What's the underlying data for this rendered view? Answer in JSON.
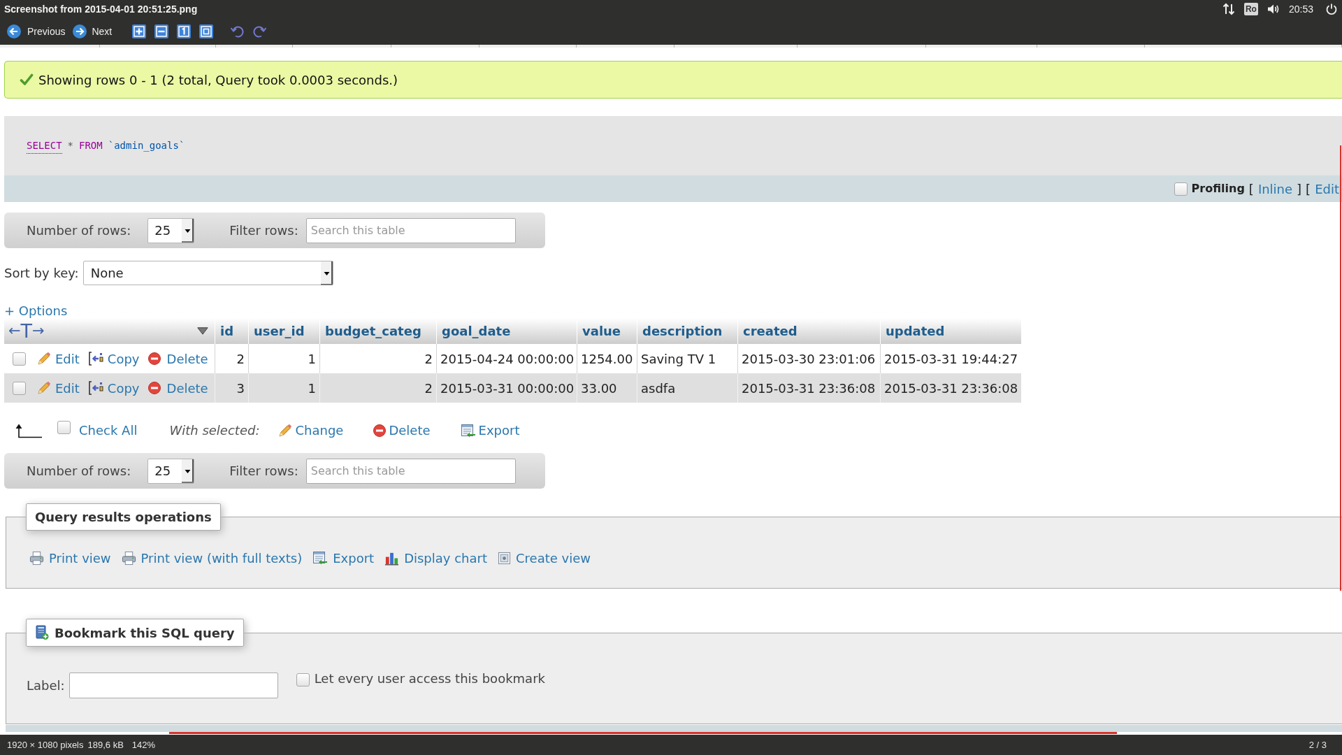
{
  "viewer": {
    "title": "Screenshot from 2015-04-01 20:51:25.png",
    "keyboard": "Ro",
    "time": "20:53",
    "previous": "Previous",
    "next": "Next"
  },
  "message": {
    "text": "Showing rows 0 - 1 (2 total, Query took 0.0003 seconds.)"
  },
  "sql": [
    {
      "kind": "keyword_link",
      "text": "SELECT"
    },
    {
      "kind": "operator",
      "text": "*"
    },
    {
      "kind": "keyword",
      "text": "FROM"
    },
    {
      "kind": "identifier",
      "text": "`admin_goals`"
    }
  ],
  "profiling": {
    "checked": false,
    "label": "Profiling",
    "parts": [
      {
        "kind": "text",
        "text": "["
      },
      {
        "kind": "link",
        "text": "Inline"
      },
      {
        "kind": "text",
        "text": "]"
      },
      {
        "kind": "text",
        "text": "["
      },
      {
        "kind": "link",
        "text": "Edit"
      }
    ]
  },
  "rows_controls_top": {
    "rows_label": "Number of rows:",
    "rows_value": "25",
    "filter_label": "Filter rows:",
    "filter_placeholder": "Search this table"
  },
  "sort": {
    "label": "Sort by key:",
    "value": "None"
  },
  "options": "+ Options",
  "table": {
    "toggle": {
      "left": "←",
      "middle": "T",
      "right": "→"
    },
    "columns": [
      {
        "label": "id",
        "kind": "number"
      },
      {
        "label": "user_id",
        "kind": "number"
      },
      {
        "label": "budget_categ",
        "kind": "number"
      },
      {
        "label": "goal_date",
        "kind": "text"
      },
      {
        "label": "value",
        "kind": "text"
      },
      {
        "label": "description",
        "kind": "text"
      },
      {
        "label": "created",
        "kind": "text"
      },
      {
        "label": "updated",
        "kind": "text"
      }
    ],
    "rows": [
      {
        "checked": false,
        "actions": [
          {
            "kind": "edit",
            "label": "Edit"
          },
          {
            "kind": "copy",
            "label": "Copy"
          },
          {
            "kind": "delete",
            "label": "Delete"
          }
        ],
        "cells": [
          "2",
          "1",
          "2",
          "2015-04-24 00:00:00",
          "1254.00",
          "Saving TV 1",
          "2015-03-30 23:01:06",
          "2015-03-31 19:44:27"
        ]
      },
      {
        "checked": false,
        "actions": [
          {
            "kind": "edit",
            "label": "Edit"
          },
          {
            "kind": "copy",
            "label": "Copy"
          },
          {
            "kind": "delete",
            "label": "Delete"
          }
        ],
        "cells": [
          "3",
          "1",
          "2",
          "2015-03-31 00:00:00",
          "33.00",
          "asdfa",
          "2015-03-31 23:36:08",
          "2015-03-31 23:36:08"
        ]
      }
    ]
  },
  "bulk": {
    "checked": false,
    "check_all": "Check All",
    "with_selected": "With selected:",
    "actions": [
      {
        "kind": "change",
        "label": "Change"
      },
      {
        "kind": "delete",
        "label": "Delete"
      },
      {
        "kind": "export",
        "label": "Export"
      }
    ]
  },
  "rows_controls_bottom": {
    "rows_label": "Number of rows:",
    "rows_value": "25",
    "filter_label": "Filter rows:",
    "filter_placeholder": "Search this table"
  },
  "operations": {
    "title": "Query results operations",
    "links": [
      {
        "kind": "print",
        "label": "Print view"
      },
      {
        "kind": "print",
        "label": "Print view (with full texts)"
      },
      {
        "kind": "export",
        "label": "Export"
      },
      {
        "kind": "chart",
        "label": "Display chart"
      },
      {
        "kind": "view",
        "label": "Create view"
      }
    ]
  },
  "bookmark": {
    "title": "Bookmark this SQL query",
    "label": "Label:",
    "share_checked": false,
    "share_label": "Let every user access this bookmark"
  },
  "status_bar": {
    "dimensions": "1920 × 1080 pixels",
    "file_size": "189,6 kB",
    "zoom": "142%",
    "position": "2 / 3"
  }
}
